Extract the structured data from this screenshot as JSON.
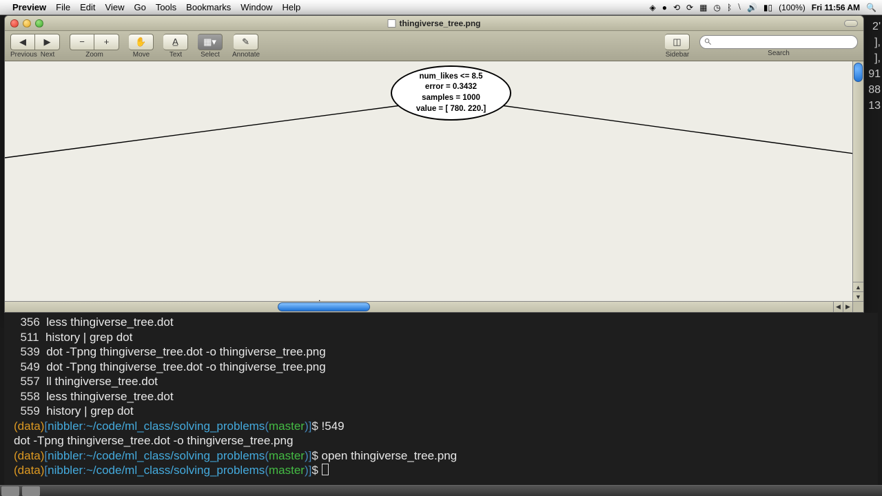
{
  "menubar": {
    "app": "Preview",
    "items": [
      "File",
      "Edit",
      "View",
      "Go",
      "Tools",
      "Bookmarks",
      "Window",
      "Help"
    ],
    "battery": "(100%)",
    "clock": "Fri 11:56 AM"
  },
  "window": {
    "title": "thingiverse_tree.png",
    "toolbar": {
      "prev": "Previous",
      "next": "Next",
      "zoom": "Zoom",
      "zoom_out": "−",
      "zoom_in": "+",
      "move": "Move",
      "text": "Text",
      "select": "Select",
      "annotate": "Annotate",
      "sidebar": "Sidebar",
      "search": "Search"
    }
  },
  "tree_node": {
    "line1": "num_likes <= 8.5",
    "line2": "error = 0.3432",
    "line3": "samples = 1000",
    "line4": "value = [ 780.  220.]"
  },
  "chart_data": {
    "type": "diagram",
    "note": "Decision tree root node (children off-screen)",
    "root": {
      "split_feature": "num_likes",
      "split_threshold": 8.5,
      "error": 0.3432,
      "samples": 1000,
      "value": [
        780,
        220
      ]
    }
  },
  "behind_numbers": [
    "2'",
    "],",
    "],",
    "91",
    "88",
    "13"
  ],
  "terminal": {
    "history": [
      {
        "n": "356",
        "cmd": "less thingiverse_tree.dot"
      },
      {
        "n": "511",
        "cmd": "history | grep dot"
      },
      {
        "n": "539",
        "cmd": "dot -Tpng thingiverse_tree.dot -o thingiverse_tree.png"
      },
      {
        "n": "549",
        "cmd": "dot -Tpng thingiverse_tree.dot -o thingiverse_tree.png"
      },
      {
        "n": "557",
        "cmd": "ll thingiverse_tree.dot"
      },
      {
        "n": "558",
        "cmd": "less thingiverse_tree.dot"
      },
      {
        "n": "559",
        "cmd": "history | grep dot"
      }
    ],
    "prompt": {
      "env": "(data)",
      "host": "nibbler",
      "path": "~/code/ml_class/solving_problems",
      "branch": "master"
    },
    "lines": [
      {
        "cmd": "!549"
      },
      {
        "echo": "dot -Tpng thingiverse_tree.dot -o thingiverse_tree.png"
      },
      {
        "cmd": "open thingiverse_tree.png"
      },
      {
        "cmd": ""
      }
    ]
  }
}
